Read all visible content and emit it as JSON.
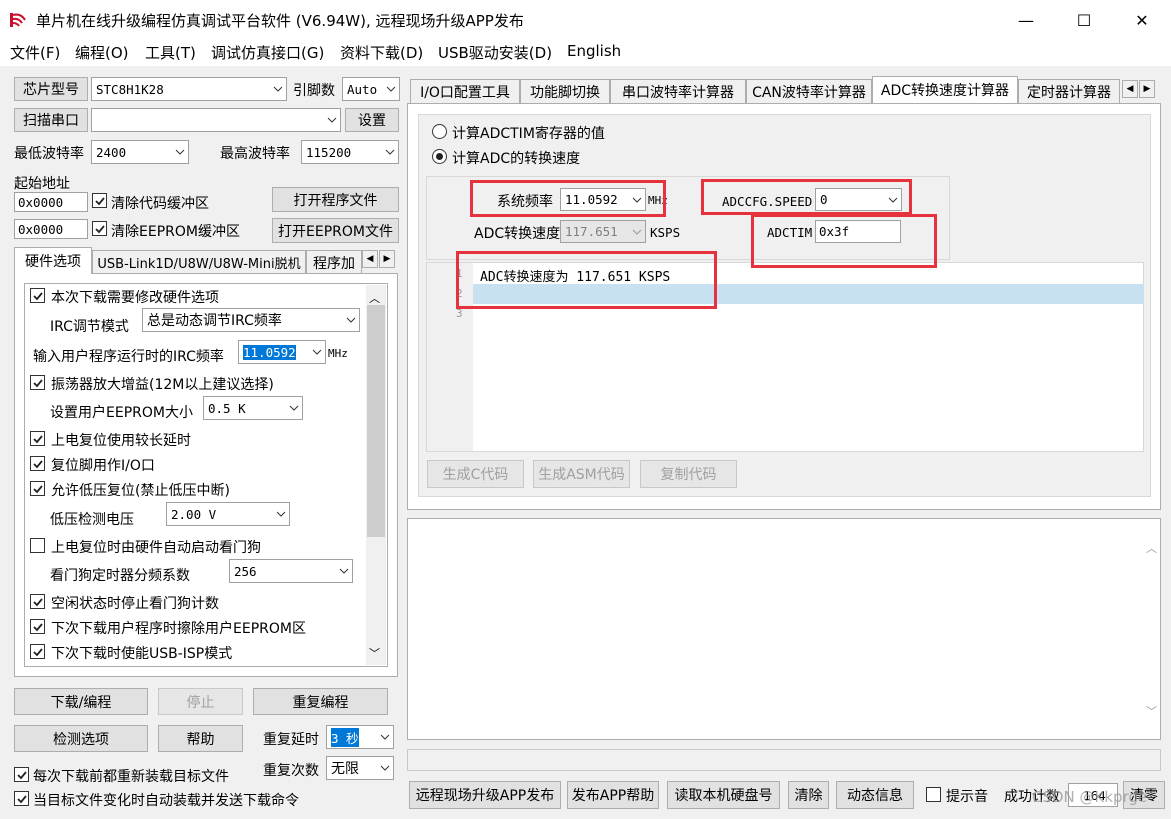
{
  "window": {
    "title": "单片机在线升级编程仿真调试平台软件 (V6.94W), 远程现场升级APP发布",
    "minimize": "—",
    "maximize": "☐",
    "close": "✕"
  },
  "menu": [
    "文件(F)",
    "编程(O)",
    "工具(T)",
    "调试仿真接口(G)",
    "资料下载(D)",
    "USB驱动安装(D)",
    "English"
  ],
  "left": {
    "chip_btn": "芯片型号",
    "chip_value": "STC8H1K28",
    "pin_label": "引脚数",
    "pin_value": "Auto",
    "scan_btn": "扫描串口",
    "port_value": "",
    "set_btn": "设置",
    "min_baud_label": "最低波特率",
    "min_baud_value": "2400",
    "max_baud_label": "最高波特率",
    "max_baud_value": "115200",
    "start_addr_label": "起始地址",
    "addr1": "0x0000",
    "clear_code": "清除代码缓冲区",
    "open_prog": "打开程序文件",
    "addr2": "0x0000",
    "clear_eeprom": "清除EEPROM缓冲区",
    "open_eeprom": "打开EEPROM文件",
    "tabs": [
      "硬件选项",
      "USB-Link1D/U8W/U8W-Mini脱机",
      "程序加"
    ],
    "hw": {
      "opt1": "本次下载需要修改硬件选项",
      "irc_mode_label": "IRC调节模式",
      "irc_mode_value": "总是动态调节IRC频率",
      "irc_freq_label": "输入用户程序运行时的IRC频率",
      "irc_freq_value": "11.0592",
      "irc_freq_unit": "MHz",
      "opt2": "振荡器放大增益(12M以上建议选择)",
      "eeprom_label": "设置用户EEPROM大小",
      "eeprom_value": "0.5 K",
      "opt3": "上电复位使用较长延时",
      "opt4": "复位脚用作I/O口",
      "opt5": "允许低压复位(禁止低压中断)",
      "lv_label": "低压检测电压",
      "lv_value": "2.00 V",
      "opt6": "上电复位时由硬件自动启动看门狗",
      "wdt_label": "看门狗定时器分频系数",
      "wdt_value": "256",
      "opt7": "空闲状态时停止看门狗计数",
      "opt8": "下次下载用户程序时擦除用户EEPROM区",
      "opt9": "下次下载时使能USB-ISP模式"
    },
    "download_btn": "下载/编程",
    "stop_btn": "停止",
    "reprog_btn": "重复编程",
    "detect_btn": "检测选项",
    "help_btn": "帮助",
    "repeat_delay_label": "重复延时",
    "repeat_delay_value": "3 秒",
    "repeat_count_label": "重复次数",
    "repeat_count_value": "无限",
    "reload_each": "每次下载前都重新装载目标文件",
    "auto_reload": "当目标文件变化时自动装载并发送下载命令"
  },
  "right": {
    "tabs": [
      "I/O口配置工具",
      "功能脚切换",
      "串口波特率计算器",
      "CAN波特率计算器",
      "ADC转换速度计算器",
      "定时器计算器"
    ],
    "radio1": "计算ADCTIM寄存器的值",
    "radio2": "计算ADC的转换速度",
    "sysfreq_label": "系统频率",
    "sysfreq_value": "11.0592",
    "sysfreq_unit": "MHz",
    "speed_label": "ADCCFG.SPEED",
    "speed_value": "0",
    "conv_label": "ADC转换速度",
    "conv_value": "117.651",
    "conv_unit": "KSPS",
    "adctim_label": "ADCTIM",
    "adctim_value": "0x3f",
    "code_lines": [
      "1",
      "2",
      "3"
    ],
    "code_text": "ADC转换速度为 117.651 KSPS",
    "gen_c": "生成C代码",
    "gen_asm": "生成ASM代码",
    "copy_code": "复制代码"
  },
  "bottom": {
    "remote": "远程现场升级APP发布",
    "publish_help": "发布APP帮助",
    "read_disk": "读取本机硬盘号",
    "clear": "清除",
    "dynamic": "动态信息",
    "beep": "提示音",
    "success_label": "成功计数",
    "success_value": "164",
    "reset": "清零"
  },
  "watermark": "CSDN @Kkprge"
}
